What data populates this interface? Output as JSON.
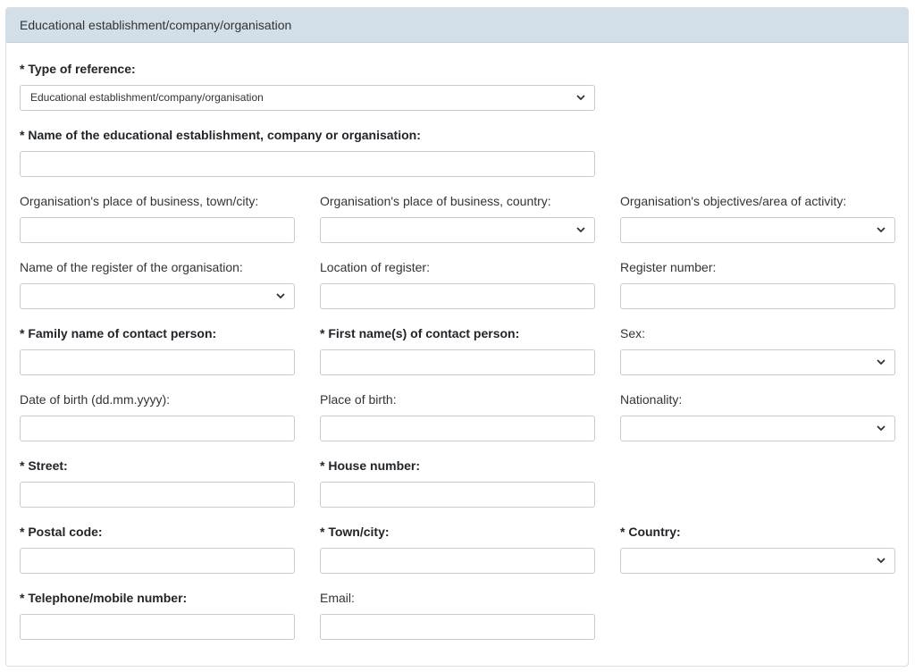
{
  "header": {
    "title": "Educational establishment/company/organisation"
  },
  "type_of_reference": {
    "label": "* Type of reference:",
    "value": "Educational establishment/company/organisation"
  },
  "org_name": {
    "label": "* Name of the educational establishment, company or organisation:"
  },
  "org_town": {
    "label": "Organisation's place of business, town/city:"
  },
  "org_country": {
    "label": "Organisation's place of business, country:"
  },
  "org_objectives": {
    "label": "Organisation's objectives/area of activity:"
  },
  "register_name": {
    "label": "Name of the register of the organisation:"
  },
  "register_location": {
    "label": "Location of register:"
  },
  "register_number": {
    "label": "Register number:"
  },
  "family_name": {
    "label": "* Family name of contact person:"
  },
  "first_names": {
    "label": "* First name(s) of contact person:"
  },
  "sex": {
    "label": "Sex:"
  },
  "dob": {
    "label": "Date of birth (dd.mm.yyyy):"
  },
  "place_of_birth": {
    "label": "Place of birth:"
  },
  "nationality": {
    "label": "Nationality:"
  },
  "street": {
    "label": "* Street:"
  },
  "house_number": {
    "label": "* House number:"
  },
  "postal_code": {
    "label": "* Postal code:"
  },
  "town": {
    "label": "* Town/city:"
  },
  "country": {
    "label": "* Country:"
  },
  "telephone": {
    "label": "* Telephone/mobile number:"
  },
  "email": {
    "label": "Email:"
  },
  "icons": {
    "dropdown": "chevron-down-icon"
  }
}
